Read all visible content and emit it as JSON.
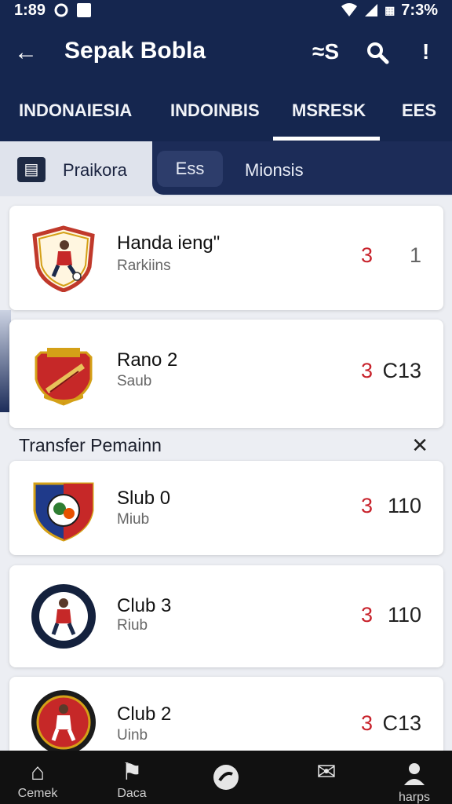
{
  "status": {
    "time": "1:89",
    "battery": "7:3%"
  },
  "appbar": {
    "back_icon": "←",
    "title": "Sepak Bobla",
    "action1": "≈S",
    "action2": "🔍",
    "action3": "!"
  },
  "tabs": [
    "INDONAIESIA",
    "INDOINBIS",
    "MSRESK",
    "EES"
  ],
  "filters": {
    "primary": "Praikora",
    "secondary": "Ess",
    "tertiary": "Mionsis"
  },
  "rows_top": [
    {
      "name": "Handa iengʺ",
      "sub": "Rarkiins",
      "score": "3",
      "value": "1"
    },
    {
      "name": "Rano 2",
      "sub": "Saub",
      "score": "3",
      "value": "C13"
    }
  ],
  "section": {
    "title": "Transfer Pemainn",
    "close": "✕"
  },
  "rows_bottom": [
    {
      "name": "Slub 0",
      "sub": "Miub",
      "score": "3",
      "value": "110"
    },
    {
      "name": "Club 3",
      "sub": "Riub",
      "score": "3",
      "value": "110"
    },
    {
      "name": "Club 2",
      "sub": "Uinb",
      "score": "3",
      "value": "C13"
    }
  ],
  "nav": [
    {
      "label": "Cemek"
    },
    {
      "label": "Daca"
    },
    {
      "label": ""
    },
    {
      "label": ""
    },
    {
      "label": "harps"
    }
  ],
  "colors": {
    "primary": "#15264f",
    "accent_red": "#c8232c",
    "nav_bg": "#111111"
  }
}
